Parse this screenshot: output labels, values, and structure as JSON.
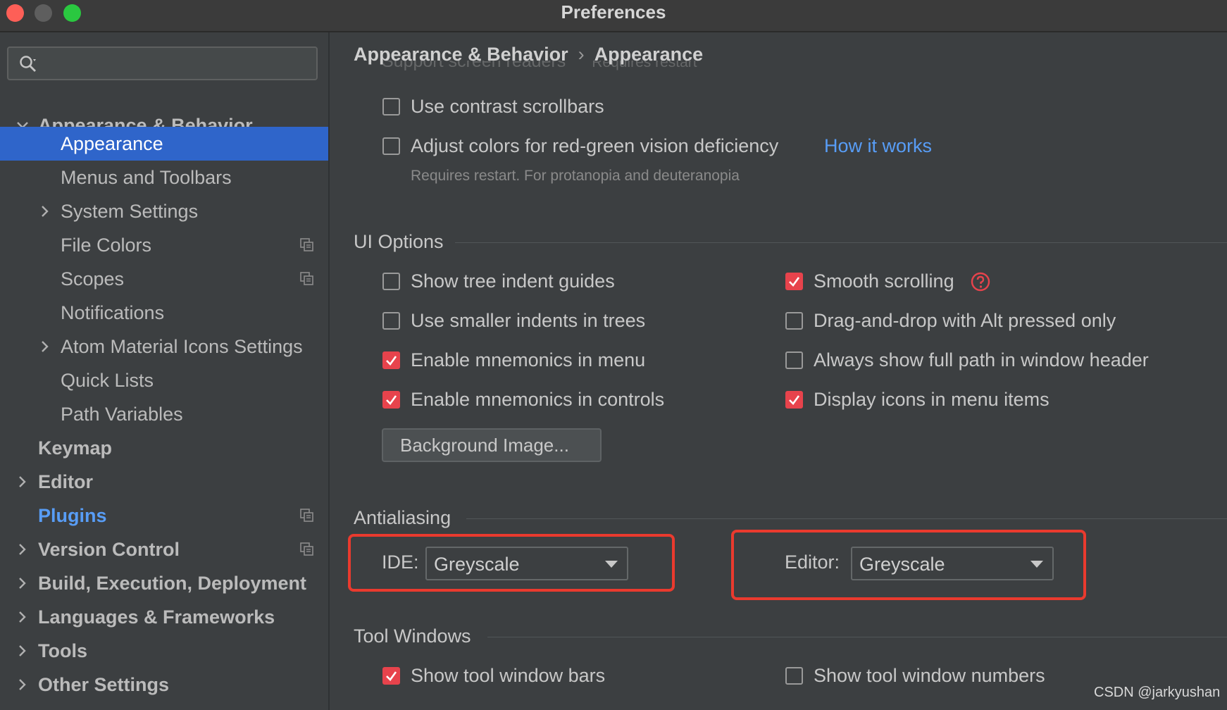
{
  "window": {
    "title": "Preferences",
    "watermark": "CSDN @jarkyushan"
  },
  "search": {
    "placeholder": "",
    "value": ""
  },
  "sidebar": {
    "items": [
      {
        "label": "Appearance & Behavior",
        "expanded": true
      },
      {
        "label": "Appearance",
        "selected": true
      },
      {
        "label": "Menus and Toolbars"
      },
      {
        "label": "System Settings"
      },
      {
        "label": "File Colors"
      },
      {
        "label": "Scopes"
      },
      {
        "label": "Notifications"
      },
      {
        "label": "Atom Material Icons Settings"
      },
      {
        "label": "Quick Lists"
      },
      {
        "label": "Path Variables"
      },
      {
        "label": "Keymap"
      },
      {
        "label": "Editor"
      },
      {
        "label": "Plugins"
      },
      {
        "label": "Version Control"
      },
      {
        "label": "Build, Execution, Deployment"
      },
      {
        "label": "Languages & Frameworks"
      },
      {
        "label": "Tools"
      },
      {
        "label": "Other Settings"
      }
    ]
  },
  "breadcrumb": {
    "parent": "Appearance & Behavior",
    "separator": "›",
    "current": "Appearance"
  },
  "accessibility": {
    "partial_option": "Support screen readers",
    "partial_hint": "Requires restart",
    "contrast_scrollbars": {
      "label": "Use contrast scrollbars",
      "checked": false
    },
    "color_deficiency": {
      "label": "Adjust colors for red-green vision deficiency",
      "checked": false
    },
    "how_it_works": "How it works",
    "color_deficiency_hint": "Requires restart. For protanopia and deuteranopia"
  },
  "ui_options": {
    "title": "UI Options",
    "left": [
      {
        "label": "Show tree indent guides",
        "checked": false
      },
      {
        "label": "Use smaller indents in trees",
        "checked": false
      },
      {
        "label": "Enable mnemonics in menu",
        "checked": true
      },
      {
        "label": "Enable mnemonics in controls",
        "checked": true
      }
    ],
    "right": [
      {
        "label": "Smooth scrolling",
        "checked": true
      },
      {
        "label": "Drag-and-drop with Alt pressed only",
        "checked": false
      },
      {
        "label": "Always show full path in window header",
        "checked": false
      },
      {
        "label": "Display icons in menu items",
        "checked": true
      }
    ],
    "background_image_button": "Background Image..."
  },
  "antialiasing": {
    "title": "Antialiasing",
    "ide_label": "IDE:",
    "ide_value": "Greyscale",
    "editor_label": "Editor:",
    "editor_value": "Greyscale"
  },
  "tool_windows": {
    "title": "Tool Windows",
    "show_bars": {
      "label": "Show tool window bars",
      "checked": true
    },
    "show_numbers": {
      "label": "Show tool window numbers",
      "checked": false
    }
  },
  "colors": {
    "accent_selection": "#2f65ca",
    "checkbox_checked": "#e7434c",
    "link": "#589df6",
    "highlight_box": "#ea3a2e"
  }
}
